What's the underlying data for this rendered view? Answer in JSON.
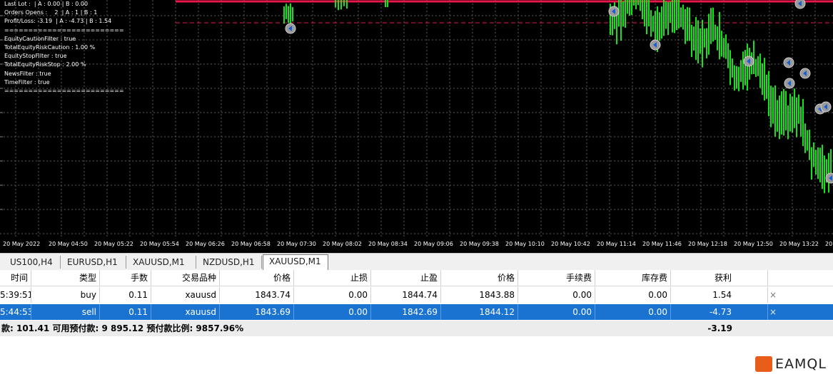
{
  "chart": {
    "info_lines": [
      "Last Lot :  | A : 0.00 | B : 0.00",
      "Orders Opens :    2  | A : 1 | B : 1",
      "Profit/Loss: -3.19  | A : -4.73 | B : 1.54",
      "=========================",
      "EquityCautionFilter : true",
      "TotalEquityRiskCaution : 1.00 %",
      "EquityStopFilter : true",
      "TotalEquityRiskStop : 2.00 %",
      "NewsFilter : true",
      "TimeFilter : true",
      "========================="
    ],
    "time_labels": [
      "20 May 2022",
      "20 May 04:50",
      "20 May 05:22",
      "20 May 05:54",
      "20 May 06:26",
      "20 May 06:58",
      "20 May 07:30",
      "20 May 08:02",
      "20 May 08:34",
      "20 May 09:06",
      "20 May 09:38",
      "20 May 10:10",
      "20 May 10:42",
      "20 May 11:14",
      "20 May 11:46",
      "20 May 12:18",
      "20 May 12:50",
      "20 May 13:22",
      "20 May 1"
    ],
    "colors": {
      "background": "#000000",
      "candles": "#17e01c",
      "grid": "#5a5a5a",
      "level_line": "#e8164b",
      "dashed_line": "#e8164b"
    }
  },
  "tabs": [
    "US100,H4",
    "EURUSD,H1",
    "XAUUSD,M1",
    "NZDUSD,H1",
    "XAUUSD,M1"
  ],
  "active_tab_index": 4,
  "table": {
    "headers": [
      "时间",
      "类型",
      "手数",
      "交易品种",
      "价格",
      "止损",
      "止盈",
      "价格",
      "手续费",
      "库存费",
      "获利"
    ],
    "rows": [
      [
        "5:39:51",
        "buy",
        "0.11",
        "xauusd",
        "1843.74",
        "0.00",
        "1844.74",
        "1843.88",
        "0.00",
        "0.00",
        "1.54"
      ],
      [
        "5:44:53",
        "sell",
        "0.11",
        "xauusd",
        "1843.69",
        "0.00",
        "1842.69",
        "1844.12",
        "0.00",
        "0.00",
        "-4.73"
      ]
    ],
    "selected_row": 1,
    "close_glyph": "×",
    "footer": {
      "summary": "款: 101.41  可用预付款: 9 895.12  预付款比例: 9857.96%",
      "total": "-3.19"
    }
  },
  "brand": {
    "text": "EAMQL"
  }
}
